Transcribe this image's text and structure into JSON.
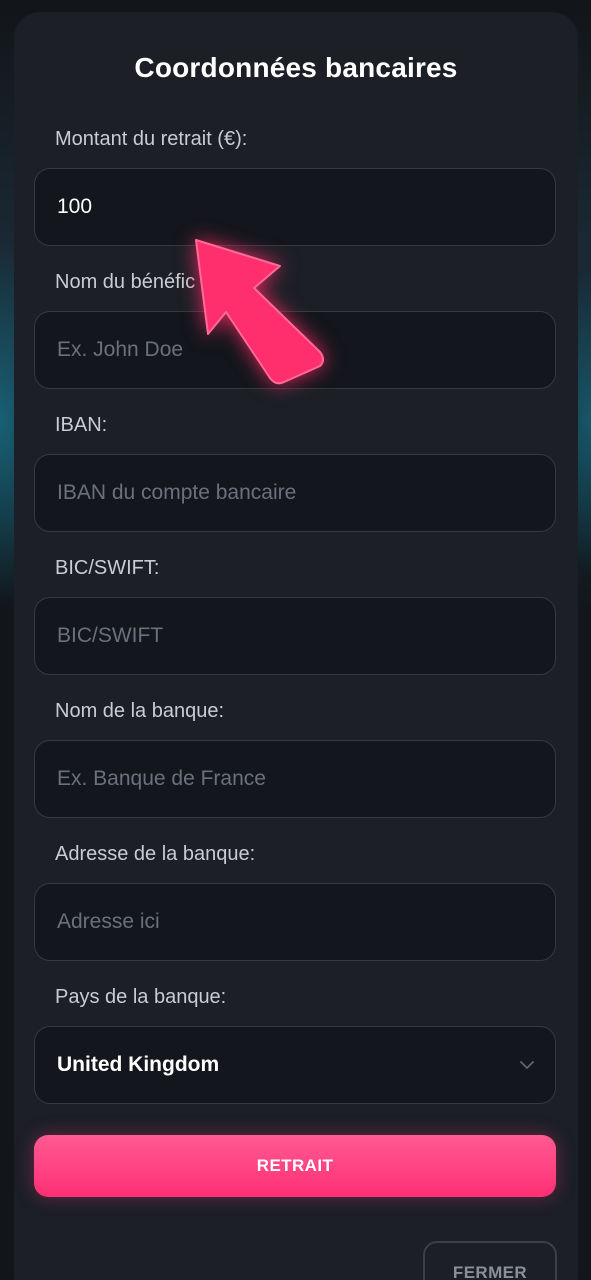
{
  "modal": {
    "title": "Coordonnées bancaires"
  },
  "fields": {
    "amount": {
      "label": "Montant du retrait (€):",
      "value": "100",
      "placeholder": ""
    },
    "beneficiary": {
      "label": "Nom du bénéfic",
      "value": "",
      "placeholder": "Ex. John Doe"
    },
    "iban": {
      "label": "IBAN:",
      "value": "",
      "placeholder": "IBAN du compte bancaire"
    },
    "bic": {
      "label": "BIC/SWIFT:",
      "value": "",
      "placeholder": "BIC/SWIFT"
    },
    "bank_name": {
      "label": "Nom de la banque:",
      "value": "",
      "placeholder": "Ex. Banque de France"
    },
    "bank_address": {
      "label": "Adresse de la banque:",
      "value": "",
      "placeholder": "Adresse ici"
    },
    "bank_country": {
      "label": "Pays de la banque:",
      "selected": "United Kingdom"
    }
  },
  "buttons": {
    "withdraw": "RETRAIT",
    "close": "FERMER"
  },
  "colors": {
    "accent": "#ff3a7c",
    "modal_bg": "#1c1f26",
    "field_bg": "#13161c"
  },
  "icons": {
    "dropdown": "chevron-down-icon",
    "annotation": "pointer-arrow-icon"
  }
}
